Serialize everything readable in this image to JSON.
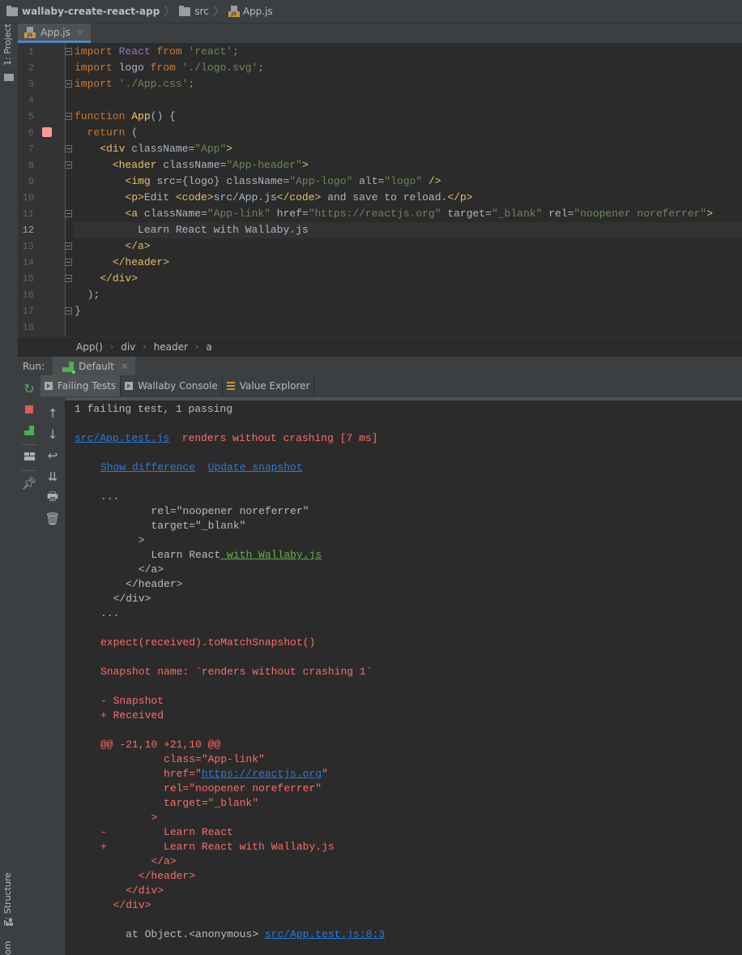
{
  "navbar": {
    "crumbs": [
      {
        "label": "wallaby-create-react-app",
        "icon": "folder-icon"
      },
      {
        "label": "src",
        "icon": "folder-icon"
      },
      {
        "label": "App.js",
        "icon": "js-file-icon"
      }
    ]
  },
  "left_strip": {
    "project_label": "1: Project",
    "structure_label": "Z: Structure",
    "bottom_partial_label": "om"
  },
  "editor": {
    "tab": {
      "label": "App.js",
      "icon": "js-file-icon",
      "file_badge": "JS"
    },
    "caret_line": 12,
    "breakpoint_line": 6,
    "lines": [
      {
        "n": "1"
      },
      {
        "n": "2"
      },
      {
        "n": "3"
      },
      {
        "n": "4"
      },
      {
        "n": "5"
      },
      {
        "n": "6"
      },
      {
        "n": "7"
      },
      {
        "n": "8"
      },
      {
        "n": "9"
      },
      {
        "n": "10"
      },
      {
        "n": "11"
      },
      {
        "n": "12"
      },
      {
        "n": "13"
      },
      {
        "n": "14"
      },
      {
        "n": "15"
      },
      {
        "n": "16"
      },
      {
        "n": "17"
      },
      {
        "n": "18"
      }
    ],
    "code": {
      "l1": [
        "import",
        " ",
        "React",
        " ",
        "from",
        " ",
        "'react'",
        ";"
      ],
      "l2": [
        "import",
        " logo ",
        "from",
        " ",
        "'./logo.svg'",
        ";"
      ],
      "l3": [
        "import",
        " ",
        "'./App.css'",
        ";"
      ],
      "l5": [
        "function",
        " ",
        "App",
        "() {"
      ],
      "l6": [
        "  ",
        "return",
        " ("
      ],
      "l7": [
        "    ",
        "<div",
        " className",
        "=",
        "\"App\"",
        ">"
      ],
      "l8": [
        "      ",
        "<header",
        " className",
        "=",
        "\"App-header\"",
        ">"
      ],
      "l9": [
        "        ",
        "<img",
        " src",
        "={logo}",
        " className",
        "=",
        "\"App-logo\"",
        " alt",
        "=",
        "\"logo\"",
        " />"
      ],
      "l10": [
        "        ",
        "<p>",
        "Edit ",
        "<code>",
        "src/App.js",
        "</code>",
        " and save to reload.",
        "</p>"
      ],
      "l11": [
        "        ",
        "<a",
        " className",
        "=",
        "\"App-link\"",
        " href",
        "=",
        "\"https://reactjs.org\"",
        " target",
        "=",
        "\"_blank\"",
        " rel",
        "=",
        "\"noopener noreferrer\"",
        ">"
      ],
      "l12": [
        "          Learn React with Wallaby.js"
      ],
      "l13": [
        "        ",
        "</a>"
      ],
      "l14": [
        "      ",
        "</header>"
      ],
      "l15": [
        "    ",
        "</div>"
      ],
      "l16": [
        "  );"
      ],
      "l17": [
        "}"
      ]
    },
    "breadcrumb": [
      "App()",
      "div",
      "header",
      "a"
    ]
  },
  "run": {
    "label": "Run:",
    "tab": {
      "label": "Default"
    },
    "subtabs": [
      {
        "label": "Failing Tests",
        "active": true
      },
      {
        "label": "Wallaby Console",
        "active": false
      },
      {
        "label": "Value Explorer",
        "active": false
      }
    ]
  },
  "console": {
    "summary": "1 failing test, 1 passing",
    "test_file": "src/App.test.js",
    "test_title": "renders without crashing [7 ms]",
    "show_difference": "Show difference",
    "update_snapshot": "Update snapshot",
    "snippet": [
      "...",
      "        rel=\"noopener noreferrer\"",
      "        target=\"_blank\"",
      "      >",
      "        Learn React",
      " with Wallaby.js",
      "      </a>",
      "    </header>",
      "  </div>",
      "..."
    ],
    "expect_line": "expect(received).toMatchSnapshot()",
    "snapshot_name": "Snapshot name: `renders without crashing 1`",
    "minus_snapshot": "- Snapshot",
    "plus_received": "+ Received",
    "diff": [
      "@@ -21,10 +21,10 @@",
      "          class=\"App-link\"",
      "          href=\"",
      "https://reactjs.org",
      "\"",
      "          rel=\"noopener noreferrer\"",
      "          target=\"_blank\"",
      "        >",
      "-         Learn React",
      "+         Learn React with Wallaby.js",
      "        </a>",
      "      </header>",
      "    </div>",
      "  </div>"
    ],
    "stack_prefix": "    at Object.<anonymous> ",
    "stack_link": "src/App.test.js:8:3"
  },
  "colors": {
    "error": "#ff6b68",
    "link": "#287bde",
    "added": "#62b543",
    "breakpoint": "#ff9999",
    "keyword": "#cc7832",
    "string": "#6a8759"
  }
}
